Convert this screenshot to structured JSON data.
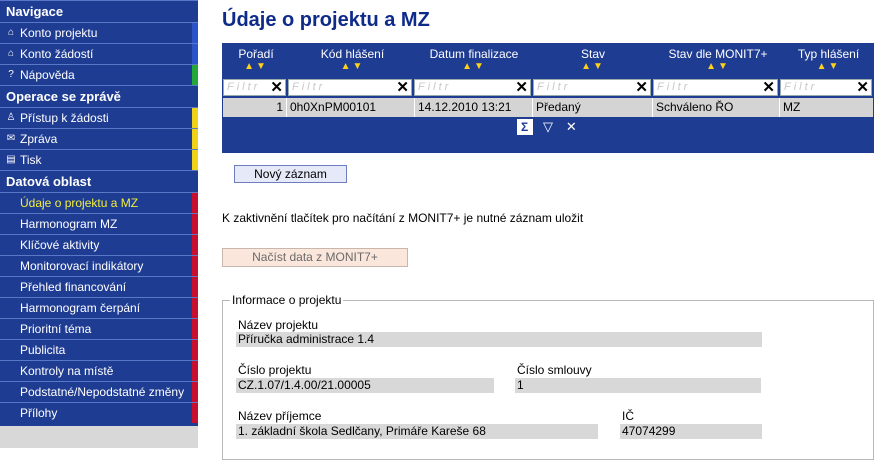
{
  "sidebar": {
    "sections": [
      {
        "title": "Navigace",
        "items": [
          {
            "icon": "home-icon",
            "glyph": "⌂",
            "label": "Konto projektu",
            "color": "#2c54c8"
          },
          {
            "icon": "home-icon",
            "glyph": "⌂",
            "label": "Konto žádostí",
            "color": "#2c54c8"
          },
          {
            "icon": "help-icon",
            "glyph": "?",
            "label": "Nápověda",
            "color": "#25a83a"
          }
        ]
      },
      {
        "title": "Operace se zprávě",
        "items": [
          {
            "icon": "user-icon",
            "glyph": "♙",
            "label": "Přístup k žádosti",
            "color": "#f1d21a"
          },
          {
            "icon": "envelope-icon",
            "glyph": "✉",
            "label": "Zpráva",
            "color": "#f1d21a"
          },
          {
            "icon": "document-icon",
            "glyph": "▤",
            "label": "Tisk",
            "color": "#f1d21a"
          }
        ]
      },
      {
        "title": "Datová oblast",
        "items": [
          {
            "label": "Údaje o projektu a MZ",
            "active": true,
            "color": "#c8102e"
          },
          {
            "label": "Harmonogram MZ",
            "color": "#c8102e"
          },
          {
            "label": "Klíčové aktivity",
            "color": "#c8102e"
          },
          {
            "label": "Monitorovací indikátory",
            "color": "#c8102e"
          },
          {
            "label": "Přehled financování",
            "color": "#c8102e"
          },
          {
            "label": "Harmonogram čerpání",
            "color": "#c8102e"
          },
          {
            "label": "Prioritní téma",
            "color": "#c8102e"
          },
          {
            "label": "Publicita",
            "color": "#c8102e"
          },
          {
            "label": "Kontroly na místě",
            "color": "#c8102e"
          },
          {
            "label": "Podstatné/Nepodstatné změny",
            "color": "#c8102e"
          },
          {
            "label": "Přílohy",
            "color": "#c8102e"
          }
        ]
      }
    ]
  },
  "page": {
    "title": "Údaje o projektu a MZ"
  },
  "grid": {
    "columns": [
      "Pořadí",
      "Kód hlášení",
      "Datum finalizace",
      "Stav",
      "Stav dle MONIT7+",
      "Typ hlášení"
    ],
    "filter_placeholder": "Filtr",
    "row": [
      "1",
      "0h0XnPM00101",
      "14.12.2010 13:21",
      "Předaný",
      "Schváleno ŘO",
      "MZ"
    ],
    "tools": [
      "sum-icon",
      "filter-icon",
      "clear-filter-icon"
    ]
  },
  "buttons": {
    "new_record": "Nový záznam",
    "load_monit": "Načíst data z MONIT7+"
  },
  "hint": "K zaktivnění tlačítek pro načítání z MONIT7+ je nutné záznam uložit",
  "project_info": {
    "legend": "Informace o projektu",
    "project_name_label": "Název projektu",
    "project_name": "Příručka administrace 1.4",
    "project_number_label": "Číslo projektu",
    "project_number": "CZ.1.07/1.4.00/21.00005",
    "contract_number_label": "Číslo smlouvy",
    "contract_number": "1",
    "recipient_label": "Název příjemce",
    "recipient": "1. základní škola Sedlčany, Primáře Kareše 68",
    "ic_label": "IČ",
    "ic": "47074299"
  }
}
